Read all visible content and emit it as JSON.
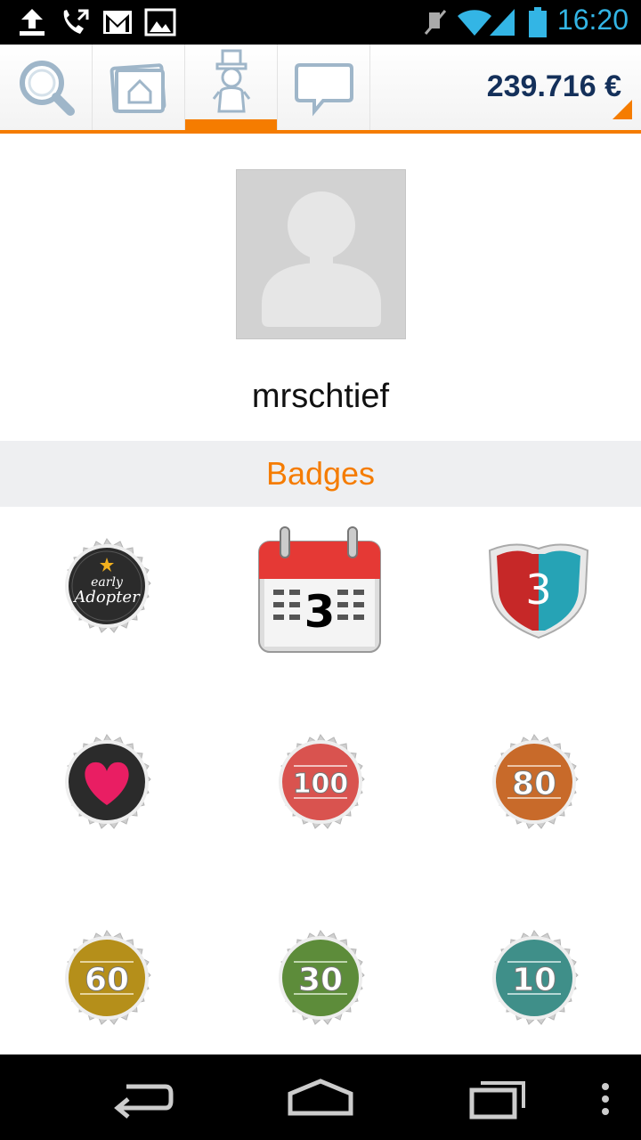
{
  "status_bar": {
    "time": "16:20",
    "icons": [
      "upload-icon",
      "missed-call-icon",
      "gmail-icon",
      "gallery-icon",
      "mute-icon",
      "wifi-icon",
      "signal-icon",
      "battery-icon"
    ]
  },
  "action_bar": {
    "tabs": [
      {
        "name": "search",
        "icon": "magnifier-icon"
      },
      {
        "name": "home",
        "icon": "home-folder-icon"
      },
      {
        "name": "profile",
        "icon": "chimney-sweep-icon",
        "active": true
      },
      {
        "name": "messages",
        "icon": "speech-bubble-icon"
      }
    ],
    "balance": "239.716 €",
    "accent_color": "#f57c00",
    "balance_color": "#14305a"
  },
  "profile": {
    "username": "mrschtief",
    "avatar": "default-person-icon"
  },
  "badges": {
    "title": "Badges",
    "items": [
      {
        "name": "early-adopter",
        "line1": "early",
        "line2": "Adopter",
        "color": "#2b2b2b"
      },
      {
        "name": "calendar-3",
        "text": "3",
        "color": "#e53935"
      },
      {
        "name": "route-shield-3",
        "text": "3",
        "color": "#c62828"
      },
      {
        "name": "heart",
        "text": "",
        "color": "#2b2b2b"
      },
      {
        "name": "level-100",
        "text": "100",
        "color": "#d9534f"
      },
      {
        "name": "level-80",
        "text": "80",
        "color": "#c86a2a"
      },
      {
        "name": "level-60",
        "text": "60",
        "color": "#b58f1a"
      },
      {
        "name": "level-30",
        "text": "30",
        "color": "#5d8c3a"
      },
      {
        "name": "level-10",
        "text": "10",
        "color": "#3f8f89"
      }
    ]
  },
  "nav_bar": {
    "buttons": [
      "back-icon",
      "home-icon",
      "recent-apps-icon",
      "menu-icon"
    ]
  }
}
